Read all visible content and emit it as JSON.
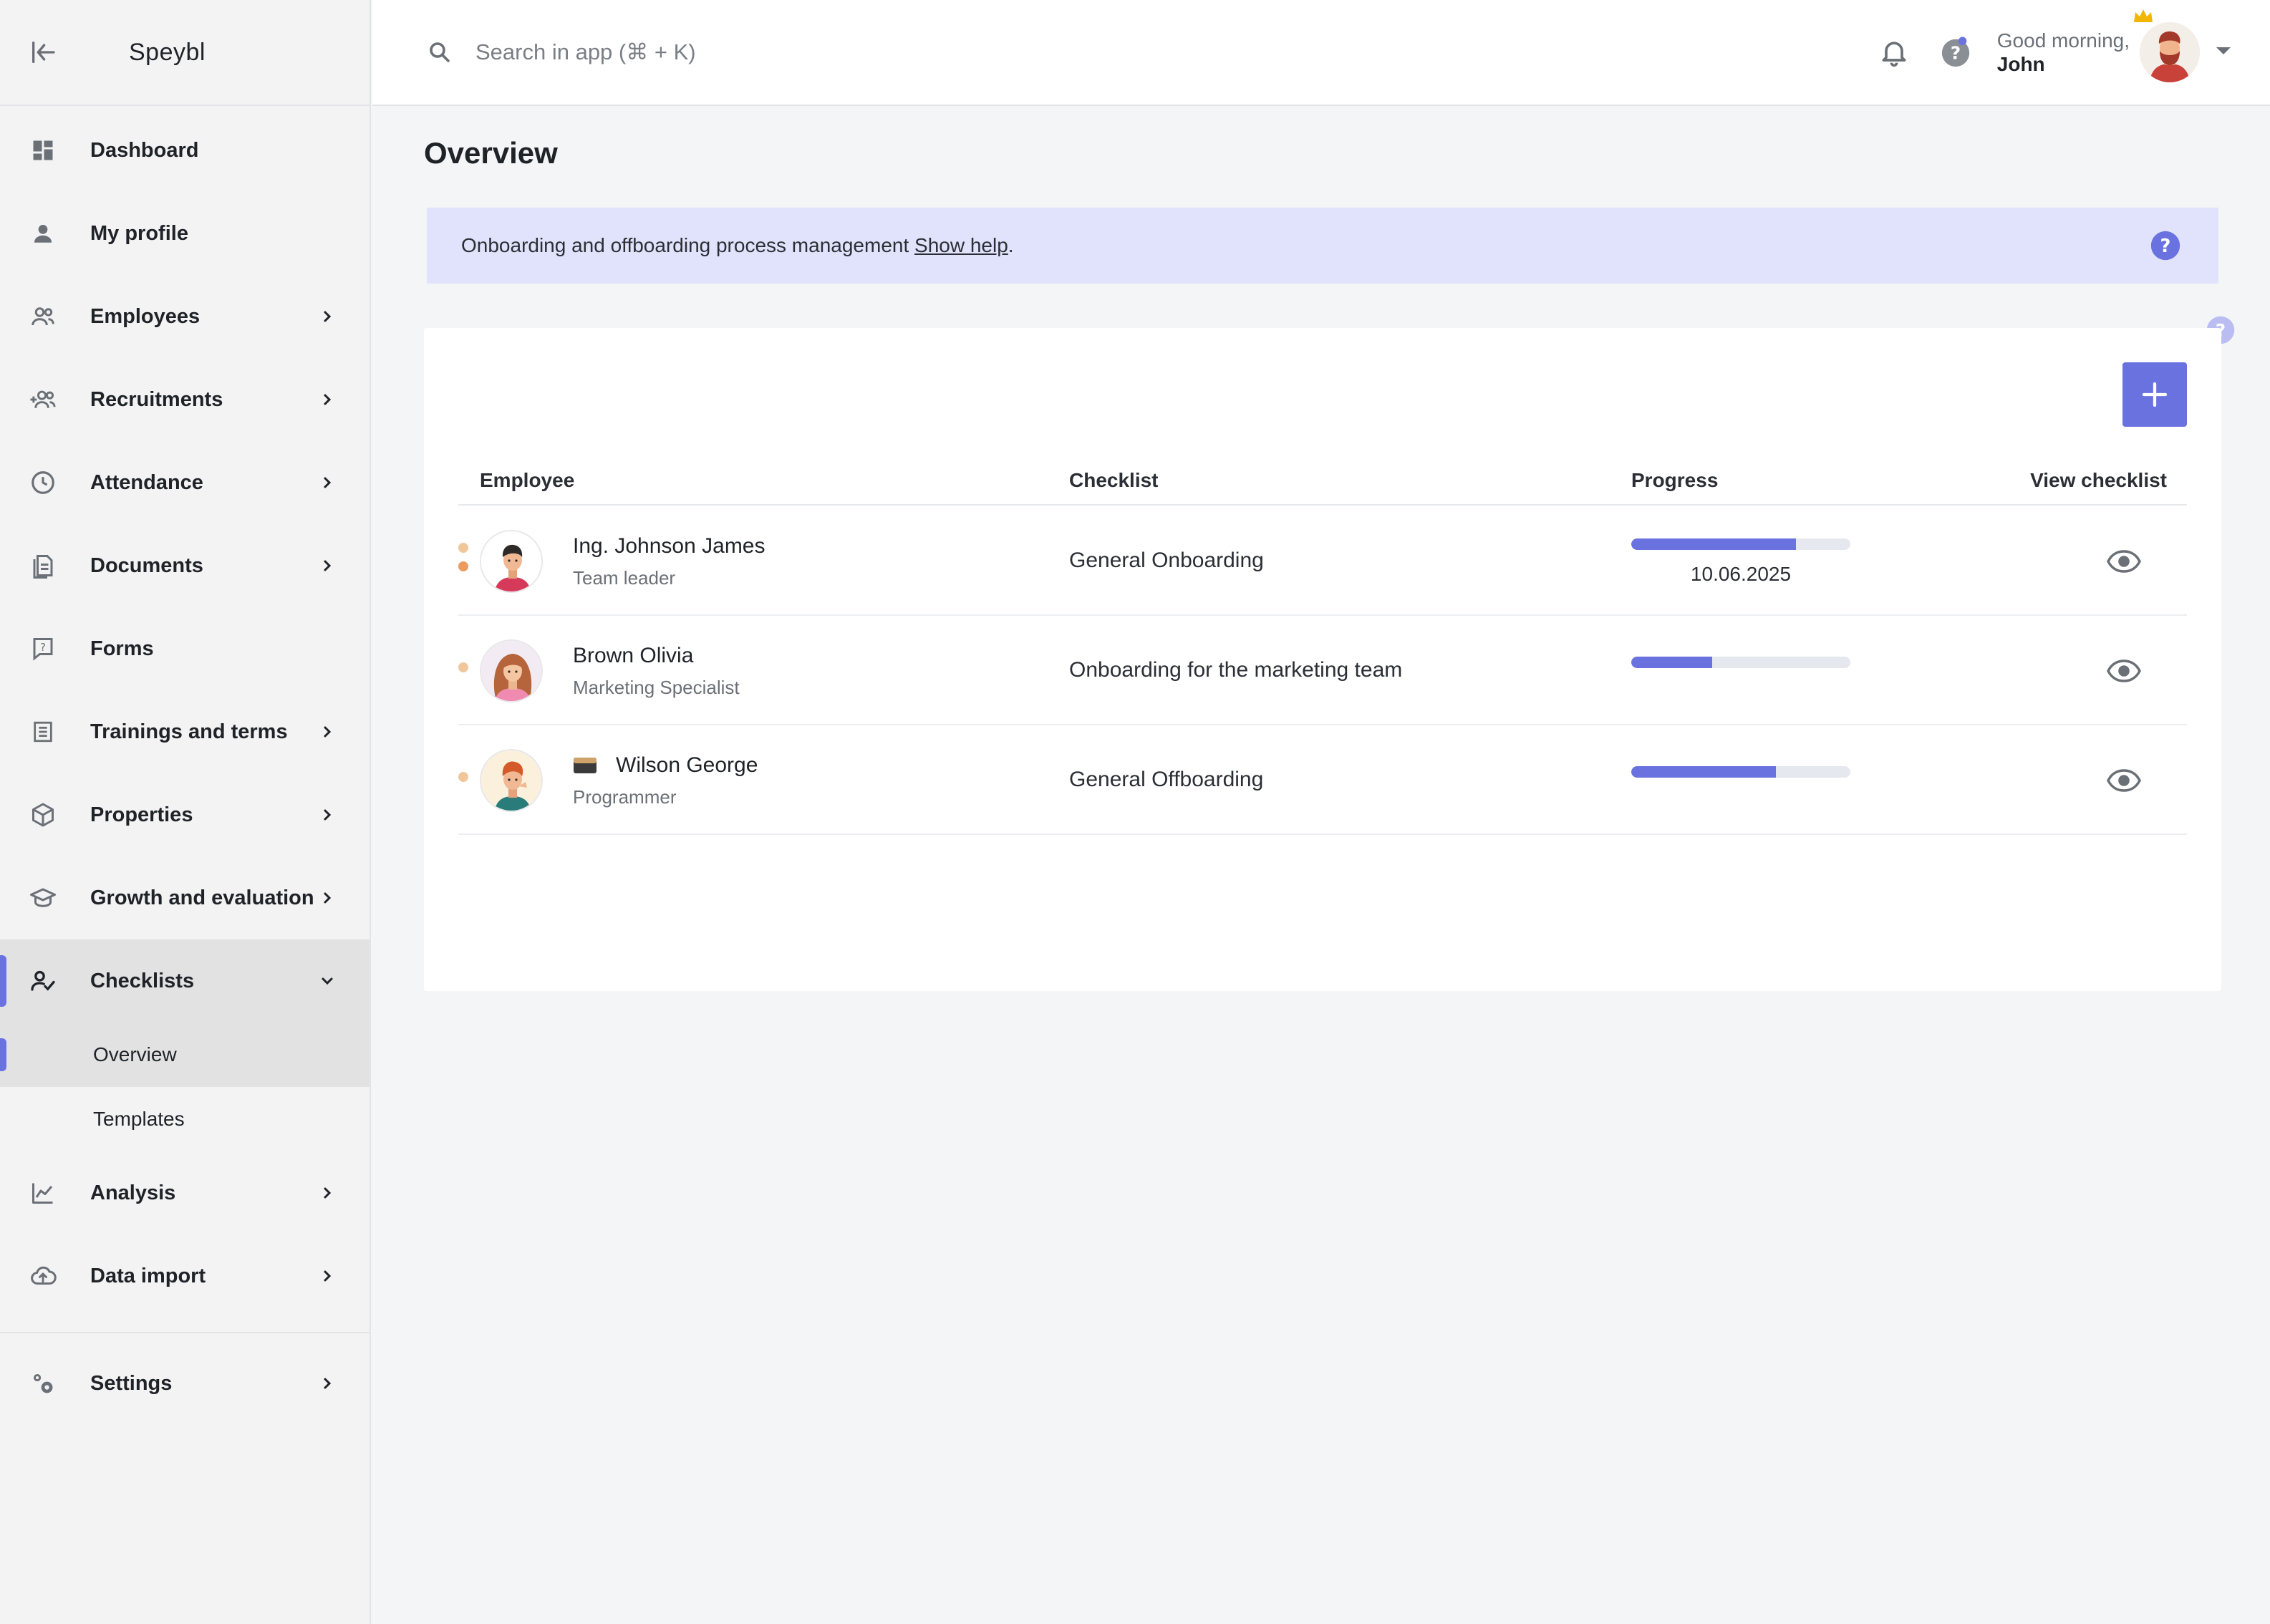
{
  "app": {
    "brand": "Speybl"
  },
  "search": {
    "placeholder": "Search in app (⌘ + K)"
  },
  "user": {
    "greeting": "Good morning,",
    "name": "John"
  },
  "sidebar": {
    "items": [
      {
        "label": "Dashboard",
        "icon": "dashboard-icon"
      },
      {
        "label": "My profile",
        "icon": "person-icon"
      },
      {
        "label": "Employees",
        "icon": "people-icon"
      },
      {
        "label": "Recruitments",
        "icon": "add-people-icon"
      },
      {
        "label": "Attendance",
        "icon": "clock-icon"
      },
      {
        "label": "Documents",
        "icon": "documents-icon"
      },
      {
        "label": "Forms",
        "icon": "form-icon"
      },
      {
        "label": "Trainings and terms",
        "icon": "list-icon"
      },
      {
        "label": "Properties",
        "icon": "box-icon"
      },
      {
        "label": "Growth and evaluation",
        "icon": "graduation-cap-icon"
      },
      {
        "label": "Checklists",
        "icon": "person-check-icon"
      },
      {
        "label": "Analysis",
        "icon": "chart-icon"
      },
      {
        "label": "Data import",
        "icon": "cloud-upload-icon"
      },
      {
        "label": "Settings",
        "icon": "gears-icon"
      }
    ],
    "sub_items": [
      {
        "label": "Overview"
      },
      {
        "label": "Templates"
      }
    ]
  },
  "main": {
    "title": "Overview",
    "help": {
      "text": "Onboarding and offboarding process management ",
      "link": "Show help",
      "suffix": "."
    },
    "table": {
      "headers": [
        "Employee",
        "Checklist",
        "Progress",
        "View checklist"
      ],
      "rows": [
        {
          "name": "Ing. Johnson James",
          "role": "Team leader",
          "checklist": "General Onboarding",
          "progress": 0.75,
          "date": "10.06.2025"
        },
        {
          "name": "Brown Olivia",
          "role": "Marketing Specialist",
          "checklist": "Onboarding for the marketing team",
          "progress": 0.37,
          "date": ""
        },
        {
          "name": "Wilson George",
          "role": "Programmer",
          "checklist": "General Offboarding",
          "progress": 0.66,
          "date": ""
        }
      ]
    }
  },
  "colors": {
    "accent": "#6a72e0",
    "banner": "#e0e3fb",
    "status_dot_light": "#f0c79a",
    "status_dot_dark": "#ec9b5f"
  }
}
